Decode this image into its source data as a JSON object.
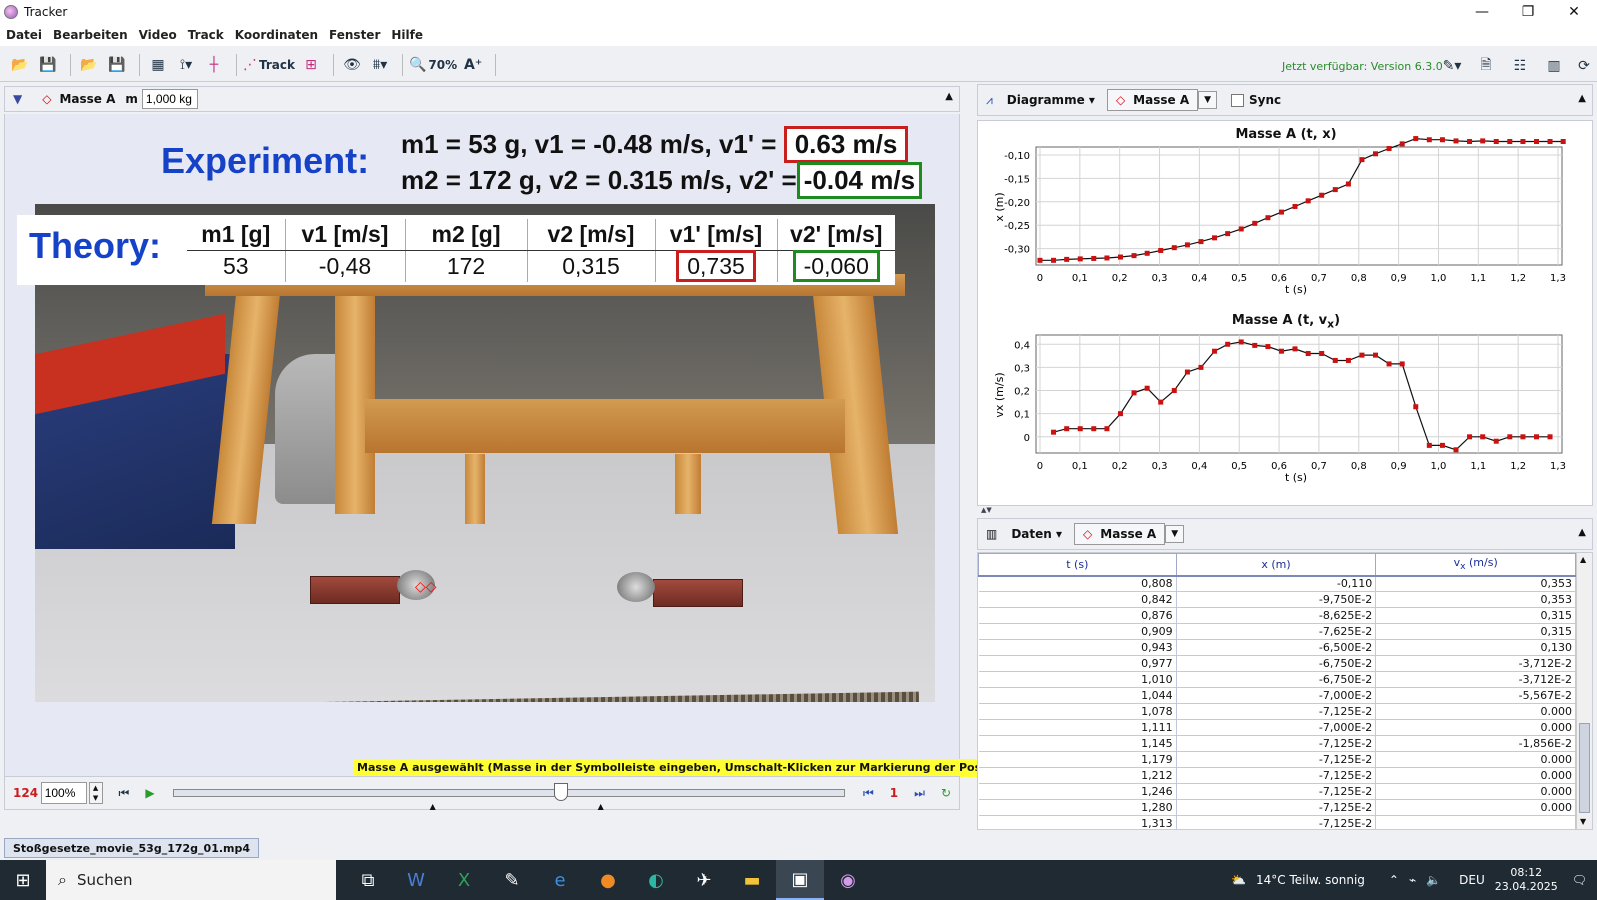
{
  "window": {
    "title": "Tracker",
    "minimize": "—",
    "maximize": "❐",
    "close": "✕"
  },
  "menu": [
    "Datei",
    "Bearbeiten",
    "Video",
    "Track",
    "Koordinaten",
    "Fenster",
    "Hilfe"
  ],
  "toolbar": {
    "track_label": "Track",
    "zoom_label": "70%",
    "update_text": "Jetzt verfügbar: Version 6.3.0"
  },
  "track_bar": {
    "track_name": "Masse A",
    "mass_label": "m",
    "mass_value": "1,000 kg"
  },
  "overlay": {
    "experiment_title": "Experiment:",
    "line1_text": "m1 = 53 g, v1 = -0.48 m/s, v1' =",
    "line1_box": "0.63 m/s",
    "line2_text": "m2 = 172 g, v2 = 0.315 m/s, v2' =",
    "line2_box": "-0.04 m/s",
    "theory_title": "Theory:",
    "theory_headers": [
      "m1 [g]",
      "v1 [m/s]",
      "m2 [g]",
      "v2 [m/s]",
      "v1' [m/s]",
      "v2' [m/s]"
    ],
    "theory_values": [
      "53",
      "-0,48",
      "172",
      "0,315",
      "0,735",
      "-0,060"
    ]
  },
  "status_text": "Masse A ausgewählt (Masse in der Symbolleiste eingeben, Umschalt-Klicken zur Markierung der Position)",
  "player": {
    "frame": "124",
    "zoom": "100%",
    "step": "1"
  },
  "file_tab": "Stoßgesetze_movie_53g_172g_01.mp4",
  "plot_panel": {
    "view_label": "Diagramme",
    "track_label": "Masse A",
    "sync_label": "Sync"
  },
  "plot1": {
    "title": "Masse A (t, x)",
    "xlabel": "t (s)",
    "ylabel": "x (m)",
    "xticks": [
      "0",
      "0,1",
      "0,2",
      "0,3",
      "0,4",
      "0,5",
      "0,6",
      "0,7",
      "0,8",
      "0,9",
      "1,0",
      "1,1",
      "1,2",
      "1,3"
    ],
    "yticks": [
      "-0,10",
      "-0,15",
      "-0,20",
      "-0,25",
      "-0,30"
    ]
  },
  "plot2": {
    "title_main": "Masse A (t, v",
    "title_sub": "x",
    "title_end": ")",
    "xlabel": "t (s)",
    "ylabel": "vx (m/s)",
    "xticks": [
      "0",
      "0,1",
      "0,2",
      "0,3",
      "0,4",
      "0,5",
      "0,6",
      "0,7",
      "0,8",
      "0,9",
      "1,0",
      "1,1",
      "1,2",
      "1,3"
    ],
    "yticks": [
      "0,4",
      "0,3",
      "0,2",
      "0,1",
      "0"
    ]
  },
  "chart_data": [
    {
      "type": "scatter",
      "title": "Masse A (t, x)",
      "xlabel": "t (s)",
      "ylabel": "x (m)",
      "xlim": [
        -0.01,
        1.31
      ],
      "ylim": [
        -0.335,
        -0.083
      ],
      "grid": true,
      "series": [
        {
          "x": [
            0.0,
            0.034,
            0.067,
            0.101,
            0.135,
            0.168,
            0.202,
            0.236,
            0.269,
            0.303,
            0.337,
            0.37,
            0.404,
            0.438,
            0.471,
            0.505,
            0.539,
            0.572,
            0.606,
            0.64,
            0.673,
            0.707,
            0.741,
            0.774,
            0.808,
            0.842,
            0.876,
            0.909,
            0.943,
            0.977,
            1.01,
            1.044,
            1.078,
            1.111,
            1.145,
            1.179,
            1.212,
            1.246,
            1.28,
            1.313
          ],
          "y": [
            -0.325,
            -0.325,
            -0.323,
            -0.322,
            -0.321,
            -0.32,
            -0.318,
            -0.315,
            -0.31,
            -0.304,
            -0.298,
            -0.292,
            -0.285,
            -0.277,
            -0.268,
            -0.258,
            -0.246,
            -0.234,
            -0.222,
            -0.21,
            -0.198,
            -0.186,
            -0.174,
            -0.162,
            -0.11,
            -0.0975,
            -0.08625,
            -0.07625,
            -0.065,
            -0.0675,
            -0.0675,
            -0.07,
            -0.07125,
            -0.07,
            -0.07125,
            -0.07125,
            -0.07125,
            -0.07125,
            -0.07125,
            -0.07125
          ]
        }
      ]
    },
    {
      "type": "line",
      "title": "Masse A (t, vx)",
      "xlabel": "t (s)",
      "ylabel": "vx (m/s)",
      "xlim": [
        -0.01,
        1.31
      ],
      "ylim": [
        -0.07,
        0.44
      ],
      "grid": true,
      "series": [
        {
          "x": [
            0.034,
            0.067,
            0.101,
            0.135,
            0.168,
            0.202,
            0.236,
            0.269,
            0.303,
            0.337,
            0.37,
            0.404,
            0.438,
            0.471,
            0.505,
            0.539,
            0.572,
            0.606,
            0.64,
            0.673,
            0.707,
            0.741,
            0.774,
            0.808,
            0.842,
            0.876,
            0.909,
            0.943,
            0.977,
            1.01,
            1.044,
            1.078,
            1.111,
            1.145,
            1.179,
            1.212,
            1.246,
            1.28
          ],
          "y": [
            0.02,
            0.035,
            0.035,
            0.035,
            0.035,
            0.1,
            0.19,
            0.21,
            0.15,
            0.2,
            0.28,
            0.3,
            0.37,
            0.4,
            0.41,
            0.395,
            0.39,
            0.37,
            0.38,
            0.36,
            0.36,
            0.33,
            0.33,
            0.353,
            0.353,
            0.315,
            0.315,
            0.13,
            -0.037,
            -0.037,
            -0.056,
            0.0,
            0.0,
            -0.019,
            0.0,
            0.0,
            0.0,
            0.0
          ]
        }
      ]
    },
    {
      "type": "table",
      "columns": [
        "t (s)",
        "x (m)",
        "vx (m/s)"
      ],
      "rows": [
        [
          "0,808",
          "-0,110",
          "0,353"
        ],
        [
          "0,842",
          "-9,750E-2",
          "0,353"
        ],
        [
          "0,876",
          "-8,625E-2",
          "0,315"
        ],
        [
          "0,909",
          "-7,625E-2",
          "0,315"
        ],
        [
          "0,943",
          "-6,500E-2",
          "0,130"
        ],
        [
          "0,977",
          "-6,750E-2",
          "-3,712E-2"
        ],
        [
          "1,010",
          "-6,750E-2",
          "-3,712E-2"
        ],
        [
          "1,044",
          "-7,000E-2",
          "-5,567E-2"
        ],
        [
          "1,078",
          "-7,125E-2",
          "0.000"
        ],
        [
          "1,111",
          "-7,000E-2",
          "0.000"
        ],
        [
          "1,145",
          "-7,125E-2",
          "-1,856E-2"
        ],
        [
          "1,179",
          "-7,125E-2",
          "0.000"
        ],
        [
          "1,212",
          "-7,125E-2",
          "0.000"
        ],
        [
          "1,246",
          "-7,125E-2",
          "0.000"
        ],
        [
          "1,280",
          "-7,125E-2",
          "0.000"
        ],
        [
          "1,313",
          "-7,125E-2",
          ""
        ]
      ]
    }
  ],
  "data_panel": {
    "view_label": "Daten",
    "track_label": "Masse A",
    "col_t": "t (s)",
    "col_x": "x (m)",
    "col_v_main": "v",
    "col_v_sub": "x",
    "col_v_end": " (m/s)"
  },
  "taskbar": {
    "search_placeholder": "Suchen",
    "weather": "14°C  Teilw. sonnig",
    "lang": "DEU",
    "time": "08:12",
    "date": "23.04.2025"
  },
  "colors": {
    "accent_blue": "#1642c8",
    "box_red": "#c81e1e",
    "box_green": "#1f8a1f",
    "track_red": "#d00000",
    "plot_line": "#111111",
    "plot_point": "#cc1111"
  }
}
